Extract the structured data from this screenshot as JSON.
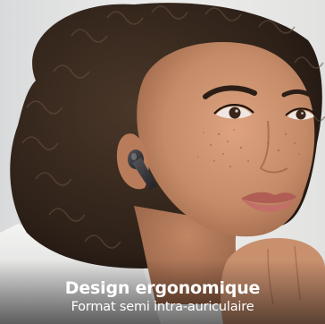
{
  "caption": {
    "title": "Design ergonomique",
    "subtitle": "Format semi intra-auriculaire"
  },
  "colors": {
    "caption_text": "#ffffff",
    "skin": "#c98f6d",
    "hair": "#3a2a20",
    "background": "#e9e9e8",
    "earbud": "#3b3b3d",
    "lips": "#b8655c"
  },
  "icons": {
    "earbud": "wireless-earbud-icon"
  }
}
